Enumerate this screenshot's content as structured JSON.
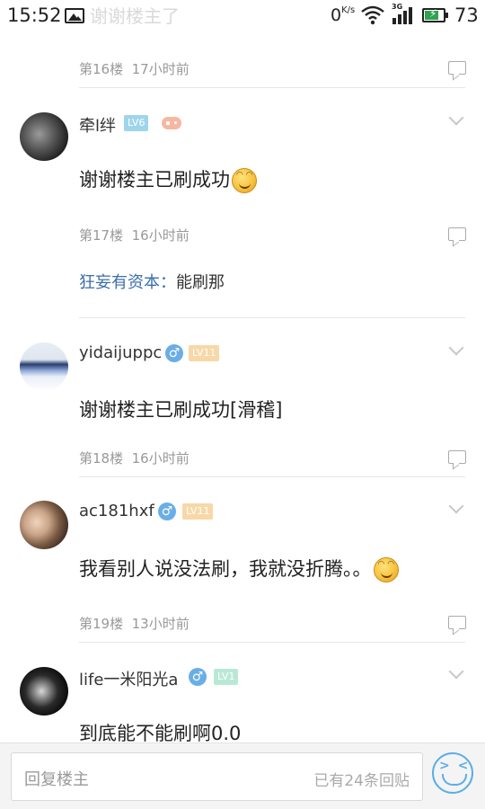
{
  "status_bar": {
    "time": "15:52",
    "ghost_text": "谢谢楼主了",
    "net_speed": "0",
    "net_unit": "K/s",
    "network_type": "3G",
    "battery_level": "73",
    "battery_fraction": 0.73
  },
  "posts": [
    {
      "floor": "第16楼",
      "time": "17小时前"
    },
    {
      "username": "牵l绊",
      "level": "LV6",
      "content": "谢谢楼主已刷成功",
      "floor": "第17楼",
      "time": "16小时前",
      "sub_reply": {
        "author": "狂妄有资本：",
        "text": "能刷那"
      }
    },
    {
      "username": "yidaijuppc",
      "gender": "♂",
      "level": "LV11",
      "content": "谢谢楼主已刷成功[滑稽]",
      "floor": "第18楼",
      "time": "16小时前"
    },
    {
      "username": "ac181hxf",
      "gender": "♂",
      "level": "LV11",
      "content": "我看别人说没法刷，我就没折腾。。",
      "floor": "第19楼",
      "time": "13小时前"
    },
    {
      "username": "life一米阳光a",
      "gender": "♂",
      "level": "LV1",
      "content": "到底能不能刷啊0.0"
    }
  ],
  "bottom_bar": {
    "placeholder": "回复楼主",
    "reply_count": "已有24条回贴"
  },
  "icons": {
    "reply": "reply-comment-icon",
    "expand": "chevron-down-icon",
    "emoji": "emoji-icon",
    "gender": "male-icon",
    "game": "game-controller-icon"
  },
  "colors": {
    "link_blue": "#3b6ea8",
    "meta_gray": "#999999",
    "emoji_button": "#5aaee8"
  }
}
